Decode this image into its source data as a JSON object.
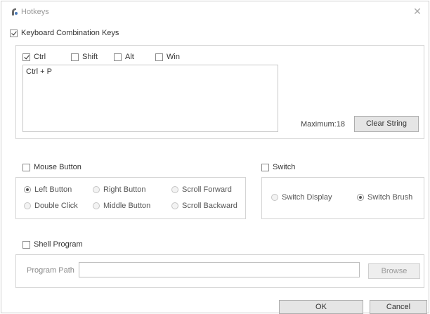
{
  "window": {
    "title": "Hotkeys",
    "close_glyph": "✕",
    "icon": "app-icon"
  },
  "keyboard": {
    "label": "Keyboard Combination Keys",
    "checked": true,
    "modifiers": [
      {
        "label": "Ctrl",
        "checked": true
      },
      {
        "label": "Shift",
        "checked": false
      },
      {
        "label": "Alt",
        "checked": false
      },
      {
        "label": "Win",
        "checked": false
      }
    ],
    "combo_text": "Ctrl + P",
    "maximum_label": "Maximum:18",
    "clear_button": "Clear String"
  },
  "mouse": {
    "label": "Mouse Button",
    "checked": false,
    "options": [
      {
        "label": "Left Button",
        "selected": true
      },
      {
        "label": "Right Button",
        "selected": false
      },
      {
        "label": "Scroll Forward",
        "selected": false
      },
      {
        "label": "Double Click",
        "selected": false
      },
      {
        "label": "Middle Button",
        "selected": false
      },
      {
        "label": "Scroll Backward",
        "selected": false
      }
    ]
  },
  "switch": {
    "label": "Switch",
    "checked": false,
    "options": [
      {
        "label": "Switch Display",
        "selected": false
      },
      {
        "label": "Switch Brush",
        "selected": true
      }
    ]
  },
  "shell": {
    "label": "Shell Program",
    "checked": false,
    "path_label": "Program Path",
    "path_value": "",
    "browse_button": "Browse"
  },
  "footer": {
    "ok_button": "OK",
    "cancel_button": "Cancel"
  }
}
